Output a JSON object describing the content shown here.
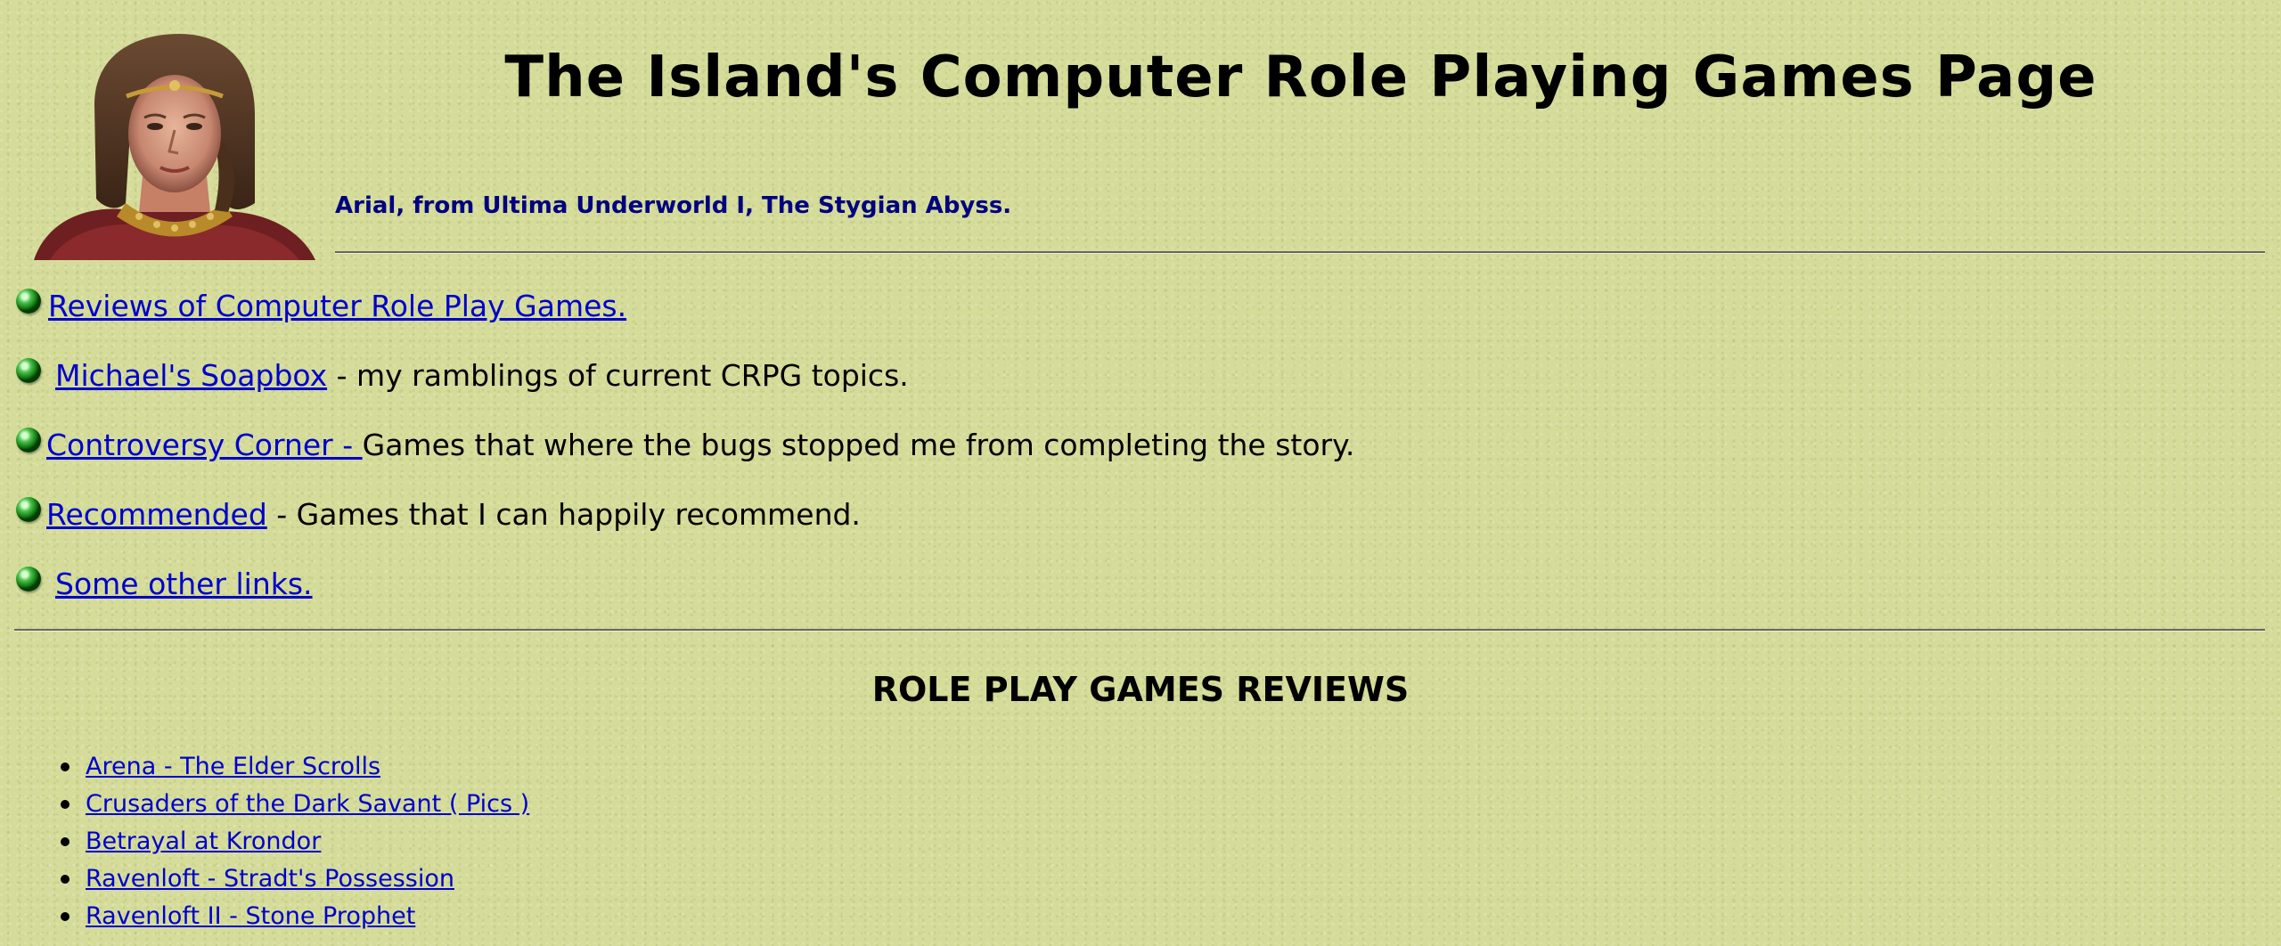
{
  "header": {
    "title": "The Island's Computer Role Playing Games Page",
    "caption": "Arial, from Ultima Underworld I, The Stygian Abyss."
  },
  "nav": [
    {
      "link": " Reviews of Computer Role Play Games.",
      "text": ""
    },
    {
      "link": "Michael's Soapbox",
      "text": " - my ramblings of current CRPG topics."
    },
    {
      "link": "Controversy Corner - ",
      "text": "Games that where the bugs stopped me from completing the story."
    },
    {
      "link": "Recommended",
      "text": " - Games that I can happily recommend."
    },
    {
      "link": "Some other links.",
      "text": ""
    }
  ],
  "reviews": {
    "heading": "ROLE PLAY GAMES REVIEWS",
    "items": [
      "Arena - The Elder Scrolls",
      "Crusaders of the Dark Savant ( Pics )",
      "Betrayal at Krondor",
      "Ravenloft - Stradt's Possession",
      "Ravenloft II - Stone Prophet"
    ]
  },
  "colors": {
    "background": "#d5dc9a",
    "link": "#0000cc",
    "caption": "#000080",
    "bullet": "#1e8a1e"
  },
  "icons": {
    "portrait": "arial-portrait-image",
    "bullet": "green-ball-icon"
  }
}
